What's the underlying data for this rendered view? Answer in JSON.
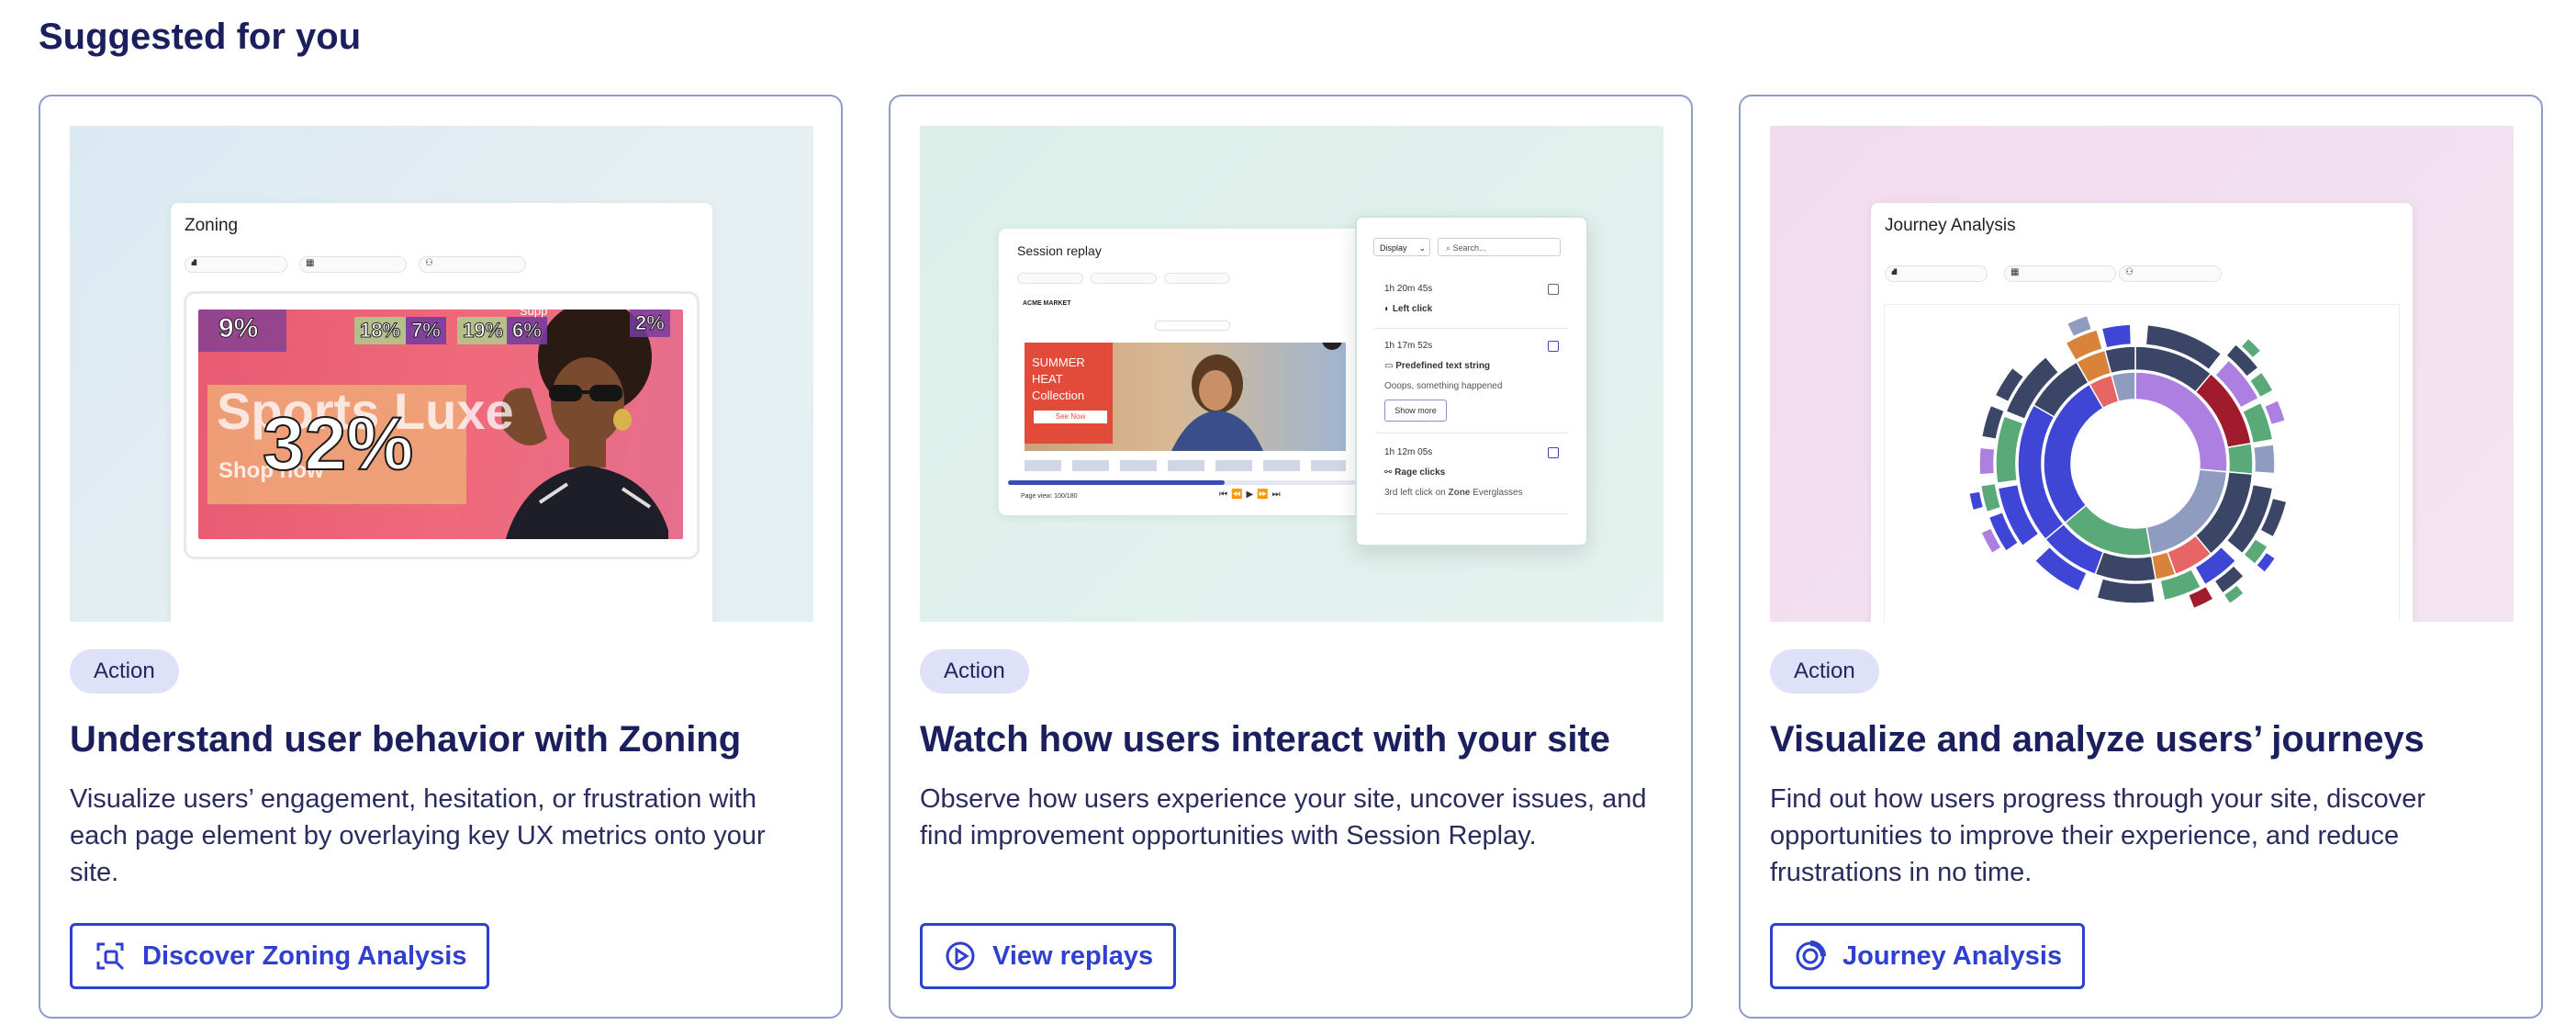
{
  "section_title": "Suggested for you",
  "cards": [
    {
      "badge": "Action",
      "title": "Understand user behavior with Zoning",
      "description": "Visualize users’ engagement, hesitation, or frustration with each page element by overlaying key UX metrics onto your site.",
      "cta_label": "Discover Zoning Analysis",
      "cta_icon": "zoning-icon",
      "preview": {
        "window_title": "Zoning",
        "hero_text": "Sports Luxe",
        "hero_cta": "Shop now",
        "metrics": {
          "main": "32%",
          "m1": "9%",
          "m2": "18%",
          "m3": "7%",
          "m4": "19%",
          "m5": "6%",
          "m6": "2%",
          "m5_label": "Supp"
        }
      }
    },
    {
      "badge": "Action",
      "title": "Watch how users interact with your site",
      "description": "Observe how users experience your site, uncover issues, and find improvement opportunities with Session Replay.",
      "cta_label": "View replays",
      "cta_icon": "play-circle-icon",
      "preview": {
        "window_title": "Session replay",
        "store_name": "ACME MARKET",
        "promo_lines": [
          "SUMMER",
          "HEAT",
          "Collection"
        ],
        "promo_button": "See Now",
        "page_view": "Page view: 100/180",
        "display_label": "Display",
        "search_placeholder": "Search...",
        "events": [
          {
            "time": "1h 20m 45s",
            "label": "Left click"
          },
          {
            "time": "1h 17m 52s",
            "label": "Predefined text string",
            "detail": "Ooops, something happened",
            "button": "Show more"
          },
          {
            "time": "1h 12m 05s",
            "label": "Rage clicks",
            "detail_prefix": "3rd left click on ",
            "detail_zone": "Zone",
            "detail_suffix": " Everglasses"
          }
        ]
      }
    },
    {
      "badge": "Action",
      "title": "Visualize and analyze users’ journeys",
      "description": "Find out how users progress through your site, discover opportunities to improve their experience, and reduce frustrations in no time.",
      "cta_label": "Journey Analysis",
      "cta_icon": "journey-icon",
      "preview": {
        "window_title": "Journey Analysis"
      }
    }
  ],
  "colors": {
    "heading": "#1c1f5e",
    "cta": "#2f3fcf",
    "badge_bg": "#dfe1f8",
    "card_border": "#8f9bc9"
  }
}
